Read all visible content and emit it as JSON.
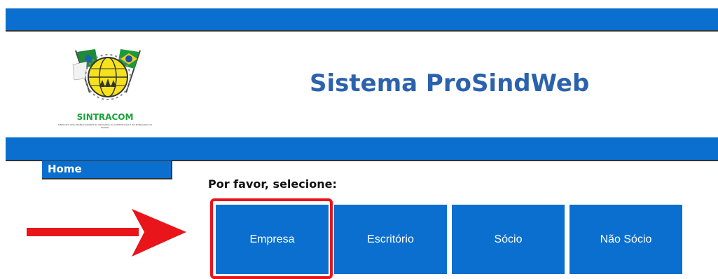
{
  "app": {
    "title": "Sistema ProSindWeb"
  },
  "logo": {
    "name": "SINTRACOM",
    "tagline": "SINDICATO DOS TRABALHADORES NA INDÚSTRIA DA CONSTRUÇÃO E DO MOBILIÁRIO DO PARANÁ"
  },
  "nav": {
    "home_label": "Home"
  },
  "main": {
    "prompt": "Por favor, selecione:",
    "options": [
      {
        "label": "Empresa"
      },
      {
        "label": "Escritório"
      },
      {
        "label": "Sócio"
      },
      {
        "label": "Não Sócio"
      }
    ]
  },
  "colors": {
    "bar_blue": "#0a6fce",
    "title_blue": "#2b62ad",
    "annotation_red": "#e8151b"
  }
}
